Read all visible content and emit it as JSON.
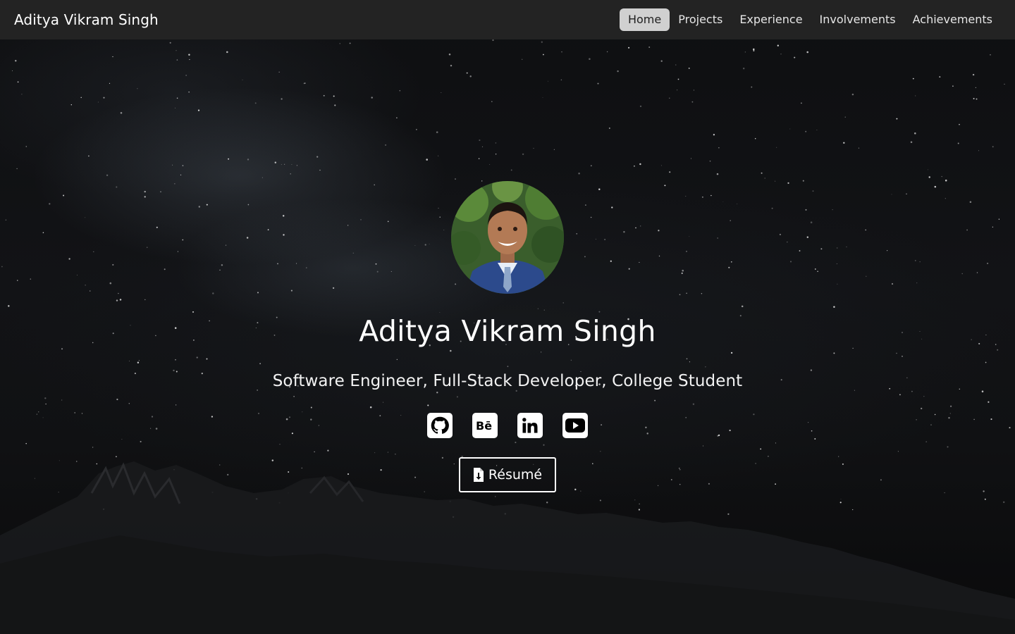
{
  "navbar": {
    "brand": "Aditya Vikram Singh",
    "links": [
      {
        "label": "Home",
        "active": true
      },
      {
        "label": "Projects",
        "active": false
      },
      {
        "label": "Experience",
        "active": false
      },
      {
        "label": "Involvements",
        "active": false
      },
      {
        "label": "Achievements",
        "active": false
      }
    ]
  },
  "hero": {
    "name": "Aditya Vikram Singh",
    "tagline": "Software Engineer, Full-Stack Developer, College Student",
    "social": [
      {
        "icon": "github-icon"
      },
      {
        "icon": "behance-icon"
      },
      {
        "icon": "linkedin-icon"
      },
      {
        "icon": "youtube-icon"
      }
    ],
    "resume_label": "Résumé",
    "resume_icon": "file-download-icon"
  },
  "colors": {
    "navbar_bg": "#232323",
    "active_link_bg": "#d0d0d0",
    "text": "#ffffff"
  }
}
